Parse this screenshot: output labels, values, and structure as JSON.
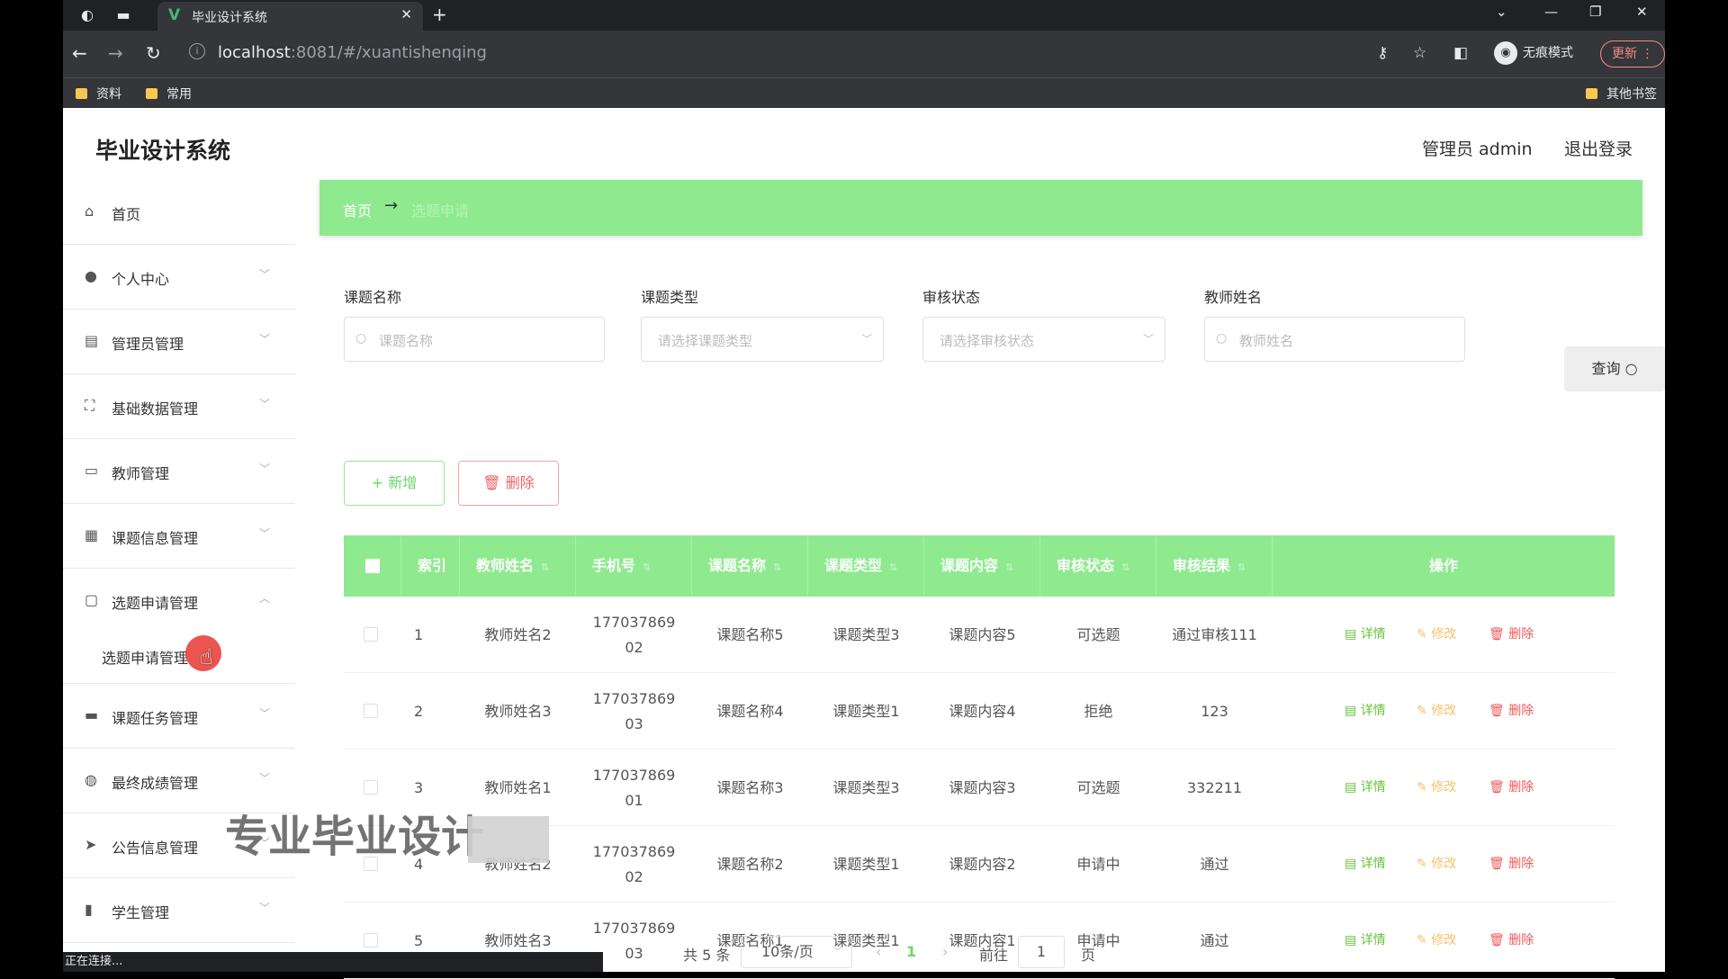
{
  "browser": {
    "tab_title": "毕业设计系统",
    "tab_close": "✕",
    "new_tab": "+",
    "url_host": "localhost",
    "url_rest": ":8081/#/xuantishenqing",
    "incognito_label": "无痕模式",
    "update_label": "更新",
    "bookmarks": [
      "资料",
      "常用"
    ],
    "other_bookmarks": "其他书签",
    "status": "正在连接..."
  },
  "app": {
    "title": "毕业设计系统",
    "user_label": "管理员 admin",
    "logout": "退出登录"
  },
  "sidebar": {
    "items": [
      {
        "label": "首页",
        "icon": "home-icon"
      },
      {
        "label": "个人中心",
        "icon": "user-icon"
      },
      {
        "label": "管理员管理",
        "icon": "clipboard-icon"
      },
      {
        "label": "基础数据管理",
        "icon": "fullscreen-icon"
      },
      {
        "label": "教师管理",
        "icon": "id-card-icon"
      },
      {
        "label": "课题信息管理",
        "icon": "chart-icon"
      },
      {
        "label": "选题申请管理",
        "icon": "chat-icon"
      },
      {
        "label": "课题任务管理",
        "icon": "monitor-icon"
      },
      {
        "label": "最终成绩管理",
        "icon": "pin-icon"
      },
      {
        "label": "公告信息管理",
        "icon": "send-icon"
      },
      {
        "label": "学生管理",
        "icon": "bar-icon"
      }
    ],
    "submenu_label": "选题申请管理"
  },
  "breadcrumb": {
    "home": "首页",
    "arrow": "→",
    "current": "选题申请"
  },
  "filters": {
    "topic_name_label": "课题名称",
    "topic_name_placeholder": "课题名称",
    "topic_type_label": "课题类型",
    "topic_type_placeholder": "请选择课题类型",
    "review_status_label": "审核状态",
    "review_status_placeholder": "请选择审核状态",
    "teacher_name_label": "教师姓名",
    "teacher_name_placeholder": "教师姓名",
    "query_label": "查询"
  },
  "actions": {
    "add_label": "新增",
    "delete_label": "删除"
  },
  "table": {
    "headers": [
      "索引",
      "教师姓名",
      "手机号",
      "课题名称",
      "课题类型",
      "课题内容",
      "审核状态",
      "审核结果",
      "操作"
    ],
    "rows": [
      {
        "index": "1",
        "teacher": "教师姓名2",
        "phone1": "177037869",
        "phone2": "02",
        "topic": "课题名称5",
        "type": "课题类型3",
        "content": "课题内容5",
        "status": "可选题",
        "result": "通过审核111"
      },
      {
        "index": "2",
        "teacher": "教师姓名3",
        "phone1": "177037869",
        "phone2": "03",
        "topic": "课题名称4",
        "type": "课题类型1",
        "content": "课题内容4",
        "status": "拒绝",
        "result": "123"
      },
      {
        "index": "3",
        "teacher": "教师姓名1",
        "phone1": "177037869",
        "phone2": "01",
        "topic": "课题名称3",
        "type": "课题类型3",
        "content": "课题内容3",
        "status": "可选题",
        "result": "332211"
      },
      {
        "index": "4",
        "teacher": "教师姓名2",
        "phone1": "177037869",
        "phone2": "02",
        "topic": "课题名称2",
        "type": "课题类型1",
        "content": "课题内容2",
        "status": "申请中",
        "result": "通过"
      },
      {
        "index": "5",
        "teacher": "教师姓名3",
        "phone1": "177037869",
        "phone2": "03",
        "topic": "课题名称1",
        "type": "课题类型1",
        "content": "课题内容1",
        "status": "申请中",
        "result": "通过"
      }
    ],
    "op_detail": "详情",
    "op_edit": "修改",
    "op_delete": "删除"
  },
  "pagination": {
    "total": "共 5 条",
    "page_size": "10条/页",
    "current_page": "1",
    "goto_prefix": "前往",
    "goto_value": "1",
    "goto_suffix": "页"
  },
  "watermark": "专业毕业设计"
}
